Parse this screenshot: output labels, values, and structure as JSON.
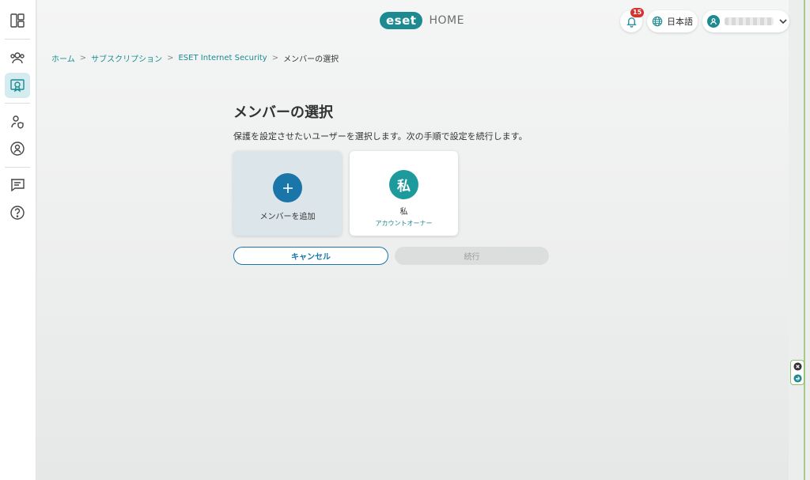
{
  "header": {
    "logo_brand": "eset",
    "logo_product": "HOME",
    "notification_count": "15",
    "language": "日本語"
  },
  "sidebar": {
    "items": [
      {
        "icon": "dashboard-icon"
      },
      {
        "icon": "people-icon"
      },
      {
        "icon": "subscription-icon",
        "active": true
      },
      {
        "icon": "user-shield-icon"
      },
      {
        "icon": "family-icon"
      },
      {
        "icon": "message-icon"
      },
      {
        "icon": "help-icon"
      }
    ]
  },
  "breadcrumb": {
    "home": "ホーム",
    "subscriptions": "サブスクリプション",
    "product": "ESET Internet Security",
    "current": "メンバーの選択"
  },
  "main": {
    "title": "メンバーの選択",
    "subtitle": "保護を設定させたいユーザーを選択します。次の手順で設定を続行します。",
    "add_member_label": "メンバーを追加",
    "me_avatar": "私",
    "me_label": "私",
    "me_role": "アカウントオーナー",
    "cancel_label": "キャンセル",
    "continue_label": "続行"
  },
  "colors": {
    "accent": "#1d8a92",
    "primary_button": "#1a76a8",
    "notification": "#d6332f"
  }
}
